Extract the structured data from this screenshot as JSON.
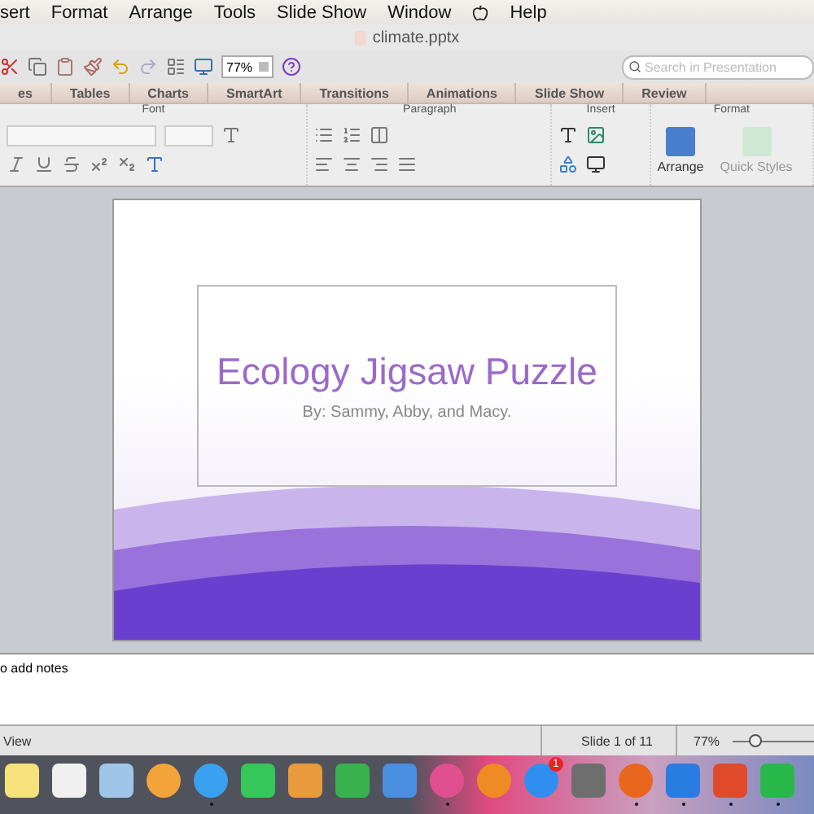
{
  "menu_bar": {
    "items": [
      "sert",
      "Format",
      "Arrange",
      "Tools",
      "Slide Show",
      "Window",
      "Help"
    ]
  },
  "window": {
    "title": "climate.pptx"
  },
  "toolbar": {
    "zoom": "77%",
    "search": {
      "placeholder": "Search in Presentation"
    }
  },
  "ribbon_tabs": [
    {
      "label": "es",
      "selected": false
    },
    {
      "label": "Tables",
      "selected": false
    },
    {
      "label": "Charts",
      "selected": false
    },
    {
      "label": "SmartArt",
      "selected": false
    },
    {
      "label": "Transitions",
      "selected": false
    },
    {
      "label": "Animations",
      "selected": false
    },
    {
      "label": "Slide Show",
      "selected": false
    },
    {
      "label": "Review",
      "selected": false
    }
  ],
  "ribbon_groups": [
    "Font",
    "Paragraph",
    "Insert",
    "Format"
  ],
  "ribbon_buttons": [
    "Arrange",
    "Quick Styles"
  ],
  "slide": {
    "title": "Ecology Jigsaw Puzzle",
    "subtitle": "By: Sammy, Abby, and Macy."
  },
  "notes": {
    "placeholder": "o add notes"
  },
  "status_bar": {
    "view": "View",
    "slide": "Slide 1 of 11",
    "zoom": "77%",
    "zoom_slider": {
      "level": 0.3
    }
  },
  "dock": [
    {
      "color": "#f5e27a",
      "running": false,
      "kind": "square"
    },
    {
      "color": "#f0f0f0",
      "running": false,
      "kind": "square"
    },
    {
      "color": "#9fc6e8",
      "running": false,
      "kind": "square"
    },
    {
      "color": "#f3a43b",
      "running": false,
      "kind": "circle"
    },
    {
      "color": "#3aa0f0",
      "running": true,
      "kind": "circle"
    },
    {
      "color": "#35c759",
      "running": false,
      "kind": "square"
    },
    {
      "color": "#e89a3c",
      "running": false,
      "kind": "square"
    },
    {
      "color": "#37b24d",
      "running": false,
      "kind": "square"
    },
    {
      "color": "#4a8fe0",
      "running": false,
      "kind": "square"
    },
    {
      "color": "#e0508f",
      "running": true,
      "kind": "circle"
    },
    {
      "color": "#f08a24",
      "running": false,
      "kind": "circle"
    },
    {
      "color": "#2f8ef0",
      "running": false,
      "kind": "circle",
      "badge": "1"
    },
    {
      "color": "#6e6e6e",
      "running": false,
      "kind": "square"
    },
    {
      "color": "#e8661e",
      "running": true,
      "kind": "circle"
    },
    {
      "color": "#2a7de0",
      "running": true,
      "kind": "square"
    },
    {
      "color": "#e04a2a",
      "running": true,
      "kind": "square"
    },
    {
      "color": "#28b84a",
      "running": true,
      "kind": "square"
    }
  ]
}
